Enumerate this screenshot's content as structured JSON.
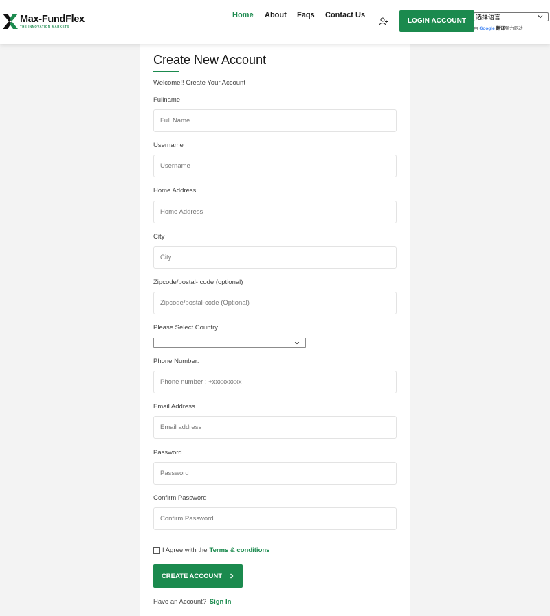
{
  "brand": {
    "name": "Max-FundFlex",
    "tagline": "THE INNOVATION MARKETS",
    "accent_color": "#1b8a4e"
  },
  "nav": {
    "items": [
      {
        "label": "Home",
        "active": true
      },
      {
        "label": "About",
        "active": false
      },
      {
        "label": "Faqs",
        "active": false
      },
      {
        "label": "Contact Us",
        "active": false
      }
    ],
    "user_icon": "user-plus-icon",
    "login_label": "LOGIN ACCOUNT"
  },
  "translate": {
    "select_label": "选择语言",
    "powered_prefix": "由",
    "powered_google": "Google",
    "powered_translate": "翻译",
    "powered_suffix": "强力驱动"
  },
  "form": {
    "title": "Create New Account",
    "subtitle": "Welcome!! Create Your Account",
    "fields": {
      "fullname": {
        "label": "Fullname",
        "placeholder": "Full Name"
      },
      "username": {
        "label": "Username",
        "placeholder": "Username"
      },
      "address": {
        "label": "Home Address",
        "placeholder": "Home Address"
      },
      "city": {
        "label": "City",
        "placeholder": "City"
      },
      "zipcode": {
        "label": "Zipcode/postal- code (optional)",
        "placeholder": "Zipcode/postal-code (Optional)"
      },
      "country": {
        "label": "Please Select Country",
        "selected": ""
      },
      "phone": {
        "label": "Phone Number:",
        "placeholder": "Phone number : +xxxxxxxxx"
      },
      "email": {
        "label": "Email Address",
        "placeholder": "Email address"
      },
      "password": {
        "label": "Password",
        "placeholder": "Password"
      },
      "confirm_password": {
        "label": "Confirm Password",
        "placeholder": "Confirm Password"
      }
    },
    "agree_text": "I Agree with the",
    "terms_link": "Terms & conditions",
    "submit_label": "CREATE ACCOUNT",
    "have_account": "Have an Account?",
    "signin_link": "Sign In"
  }
}
